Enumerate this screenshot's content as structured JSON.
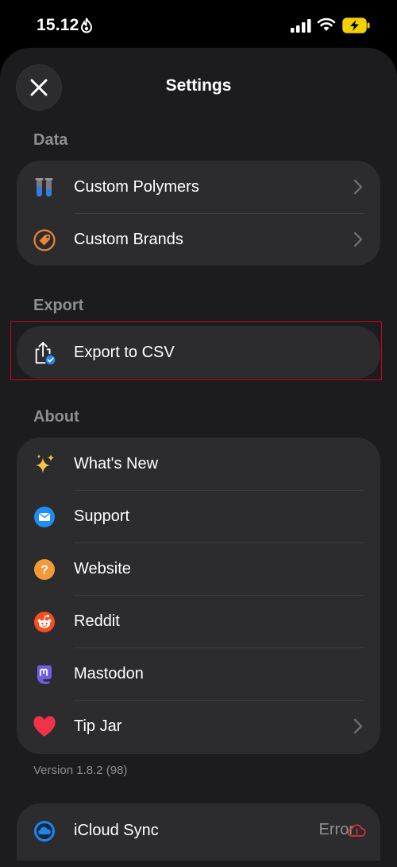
{
  "status_bar": {
    "time": "15.12"
  },
  "sheet": {
    "title": "Settings"
  },
  "sections": {
    "data": {
      "label": "Data",
      "items": [
        {
          "label": "Custom Polymers",
          "icon": "test-tubes-icon"
        },
        {
          "label": "Custom Brands",
          "icon": "tag-icon"
        }
      ]
    },
    "export": {
      "label": "Export",
      "items": [
        {
          "label": "Export to CSV",
          "icon": "share-export-icon"
        }
      ]
    },
    "about": {
      "label": "About",
      "items": [
        {
          "label": "What's New",
          "icon": "sparkles-icon"
        },
        {
          "label": "Support",
          "icon": "envelope-icon"
        },
        {
          "label": "Website",
          "icon": "question-icon"
        },
        {
          "label": "Reddit",
          "icon": "reddit-icon"
        },
        {
          "label": "Mastodon",
          "icon": "mastodon-icon"
        },
        {
          "label": "Tip Jar",
          "icon": "heart-icon"
        }
      ]
    }
  },
  "version": "Version 1.8.2 (98)",
  "icloud": {
    "label": "iCloud Sync",
    "status": "Error",
    "status_color": "#d13438"
  }
}
